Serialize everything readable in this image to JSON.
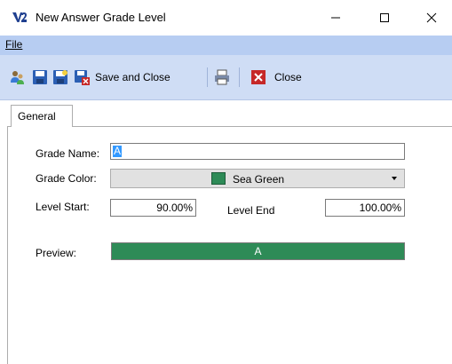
{
  "window": {
    "title": "New Answer Grade Level",
    "app_icon": "v2-app-icon",
    "minimize_icon": "minimize-icon",
    "maximize_icon": "maximize-icon",
    "close_icon": "close-icon"
  },
  "menu": {
    "file_label": "File"
  },
  "toolbar": {
    "icons": [
      "users-icon",
      "save-icon",
      "save-new-icon",
      "save-close-icon",
      "print-icon",
      "close-x-icon"
    ],
    "save_and_close_label": "Save and Close",
    "close_label": "Close"
  },
  "tabs": {
    "general_label": "General"
  },
  "form": {
    "grade_name_label": "Grade Name:",
    "grade_name_value": "A",
    "grade_color_label": "Grade Color:",
    "grade_color_value": "Sea Green",
    "grade_color_hex": "#2e8b57",
    "level_start_label": "Level Start:",
    "level_start_value": "90.00%",
    "level_end_label": "Level End",
    "level_end_value": "100.00%",
    "preview_label": "Preview:",
    "preview_value": "A"
  },
  "colors": {
    "menubar": "#b7cdf2",
    "toolbar": "#cfddf5",
    "selection": "#3399ff",
    "close_red": "#c62828"
  }
}
